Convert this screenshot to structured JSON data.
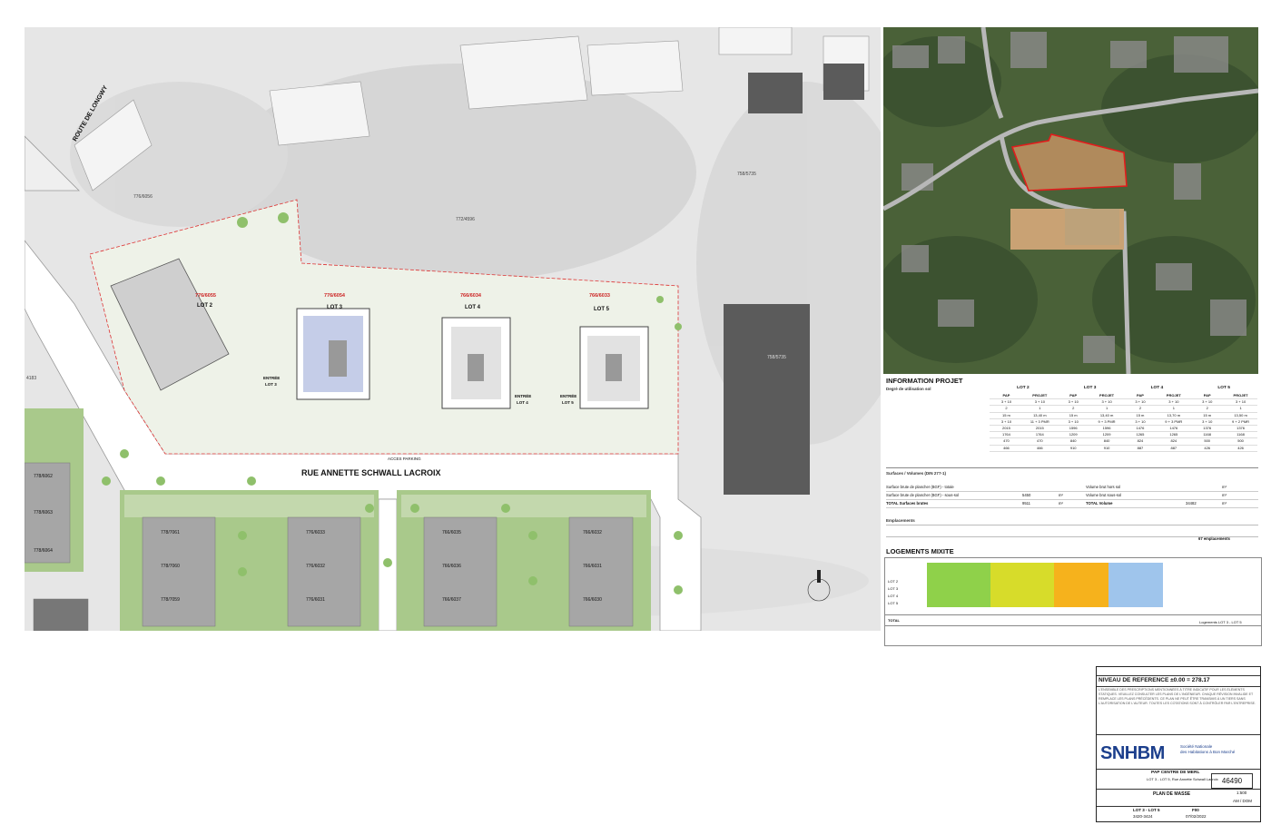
{
  "plan": {
    "street_main": "RUE ANNETTE SCHWALL LACROIX",
    "street_route": "ROUTE DE LONGWY",
    "acces_parking": "ACCES PARKING",
    "lots": [
      {
        "label": "LOT 2",
        "parcel": "776/6055"
      },
      {
        "label": "LOT 3",
        "parcel": "776/6054"
      },
      {
        "label": "LOT 4",
        "parcel": "766/6034"
      },
      {
        "label": "LOT 5",
        "parcel": "766/6033"
      }
    ],
    "entries": [
      {
        "line1": "ENTRÉE",
        "line2": "LOT 3"
      },
      {
        "line1": "ENTRÉE",
        "line2": "LOT 4"
      },
      {
        "line1": "ENTRÉE",
        "line2": "LOT 5"
      }
    ],
    "parcels_top": [
      "776/6056",
      "772/4596",
      "758/5735"
    ],
    "parcel_side": "758/5735",
    "parcels_left": [
      "778/6062",
      "778/6063",
      "778/6064"
    ],
    "parcels_south": [
      [
        "778/7061",
        "778/7060",
        "778/7059"
      ],
      [
        "776/6033",
        "776/6032",
        "776/6031"
      ],
      [
        "766/6035",
        "766/6036",
        "766/6037"
      ],
      [
        "766/6032",
        "766/6031",
        "766/6030"
      ]
    ],
    "edge_label": "4183"
  },
  "info": {
    "title": "INFORMATION PROJET",
    "subtitle": "Degré de utilisation sol",
    "lot_headers": [
      "LOT 2",
      "LOT 3",
      "LOT 4",
      "LOT 5"
    ],
    "col_headers": [
      "PAP",
      "PROJET"
    ],
    "rows": [
      [
        "",
        "",
        "",
        "",
        "",
        "",
        "",
        ""
      ],
      [
        "3 + 10",
        "3 + 10",
        "3 + 10",
        "3 + 10",
        "3 + 10",
        "3 + 10",
        "3 + 10",
        "3 + 10"
      ],
      [
        "2",
        "1",
        "2",
        "1",
        "2",
        "1",
        "2",
        "1"
      ],
      [
        "15 m",
        "13,40 m",
        "15 m",
        "13,40 m",
        "15 m",
        "13,70 m",
        "15 m",
        "13,50 m"
      ],
      [
        "3 + 10",
        "11 + 3 PMR",
        "3 + 10",
        "9 + 3 PMR",
        "3 + 10",
        "9 + 3 PMR",
        "3 + 10",
        "9 + 2 PMR"
      ],
      [
        "2015",
        "2015",
        "1596",
        "1596",
        "1476",
        "1476",
        "1376",
        "1376"
      ],
      [
        "1764",
        "1764",
        "1209",
        "1209",
        "1265",
        "1265",
        "1168",
        "1168"
      ],
      [
        "470",
        "470",
        "840",
        "840",
        "824",
        "824",
        "500",
        "500"
      ],
      [
        "466",
        "466",
        "910",
        "910",
        "887",
        "887",
        "426",
        "426"
      ]
    ],
    "surfaces_title": "Surfaces / Volumes (DIN 277-1)",
    "surfaces": [
      {
        "label": "Surface brute de plancher (BGF) - totale",
        "value": "",
        "unit": "",
        "vlabel": "Volume brut hors sol",
        "vvalue": "",
        "vunit": "m³"
      },
      {
        "label": "Surface brute de plancher (BGF) - sous-sol",
        "value": "5450",
        "unit": "m²",
        "vlabel": "Volume brut sous-sol",
        "vvalue": "",
        "vunit": "m³"
      },
      {
        "label": "TOTAL Surfaces brutes",
        "value": "9511",
        "unit": "m²",
        "vlabel": "TOTAL Volume",
        "vvalue": "34482",
        "vunit": "m³"
      }
    ],
    "parking_title": "Emplacements",
    "parking_total": "67 emplacements",
    "logements_title": "LOGEMENTS MIXITE",
    "log_rows": [
      "LOT 2",
      "LOT 3",
      "LOT 4",
      "LOT 5"
    ],
    "log_total_label": "TOTAL",
    "log_sum_label": "Logements LOT 3 - LOT 5"
  },
  "cartouche": {
    "niveau": "NIVEAU DE REFERENCE ±0.00 = 278.17",
    "notes": "L'ENSEMBLE DES PRESCRIPTIONS MENTIONNÉES À TITRE INDICATIF POUR LES ÉLÉMENTS STATIQUES. VEUILLEZ CONSULTER LES PLANS DE L'INGÉNIEUR. CHAQUE RÉVISION INVALIDE ET REMPLACE LES PLANS PRÉCÉDENTS. CE PLAN NE PEUT ÊTRE TRANSMIS À UN TIERS SANS L'AUTORISATION DE L'AUTEUR. TOUTES LES COTATIONS SONT À CONTRÔLER PAR L'ENTREPRISE.",
    "logo": "SNHBM",
    "company_lines": [
      "Société Nationale",
      "des Habitations à Bon Marché"
    ],
    "project_name": "PAP CENTRE DE MERL",
    "project_address": "LOT 3 - LOT 5, Rue Annette Schwall Lacroix",
    "project_number": "46490",
    "plan_name": "PLAN DE MASSE",
    "scale": "1:500",
    "author": "AM / DOM",
    "phase": "PAP",
    "lot_ref": "LOT 3 - LOT 5",
    "code": "F00",
    "date": "07/02/2022",
    "plan_no": "3420-3424"
  }
}
